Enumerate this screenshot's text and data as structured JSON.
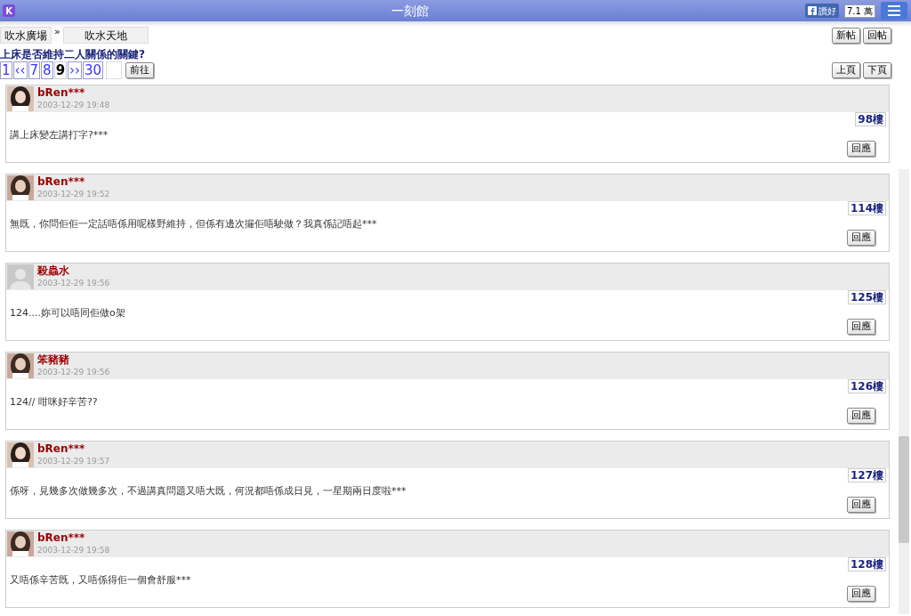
{
  "header": {
    "logo": "K",
    "title": "一刻館",
    "like_button": "讚好",
    "like_count": "7.1 萬"
  },
  "breadcrumbs": [
    "吹水廣場",
    "»",
    "吹水天地"
  ],
  "actions": [
    "新帖",
    "回帖"
  ],
  "thread_title": "上床是否維持二人關係的關鍵?",
  "pagination": [
    {
      "label": "1",
      "selected": false
    },
    {
      "label": "‹‹",
      "selected": false
    },
    {
      "label": "7",
      "selected": false
    },
    {
      "label": "8",
      "selected": false
    },
    {
      "label": "9",
      "selected": true
    },
    {
      "label": "››",
      "selected": false
    },
    {
      "label": "30",
      "selected": false
    }
  ],
  "goto_button": "前往",
  "page_nav": [
    "上頁",
    "下頁"
  ],
  "posts": [
    {
      "kind": "picture",
      "author": "bRen***",
      "date": "2003-12-29 19:48",
      "floor": "98樓",
      "text": "講上床變左講打字?***",
      "reply": "回應"
    },
    {
      "kind": "picture",
      "author": "bRen***",
      "date": "2003-12-29 19:52",
      "floor": "114樓",
      "text": "無既，你問佢佢一定話唔係用呢樣野維持，但係有邊次攞佢唔駛做？我真係記唔起***",
      "reply": "回應"
    },
    {
      "kind": "default",
      "author": "殺蟲水",
      "date": "2003-12-29 19:56",
      "floor": "125樓",
      "text": "124....妳可以唔同佢做o架",
      "reply": "回應"
    },
    {
      "kind": "picture",
      "author": "笨豬豬",
      "date": "2003-12-29 19:56",
      "floor": "126樓",
      "text": "124// 咁咪好辛苦??",
      "reply": "回應"
    },
    {
      "kind": "picture",
      "author": "bRen***",
      "date": "2003-12-29 19:57",
      "floor": "127樓",
      "text": "係呀，見幾多次做幾多次，不過講真問題又唔大既，何況都唔係成日見，一星期兩日度啦***",
      "reply": "回應"
    },
    {
      "kind": "picture",
      "author": "bRen***",
      "date": "2003-12-29 19:58",
      "floor": "128樓",
      "text": "又唔係辛苦既，又唔係得佢一個會舒服***",
      "reply": "回應"
    }
  ]
}
